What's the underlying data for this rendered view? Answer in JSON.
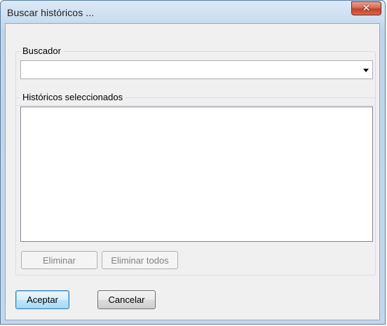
{
  "window": {
    "title": "Buscar históricos ..."
  },
  "titlebar": {
    "close_icon": "close-icon",
    "close_glyph": "✕"
  },
  "buscador": {
    "label": "Buscador",
    "value": ""
  },
  "historicos": {
    "label": "Históricos seleccionados",
    "items": []
  },
  "buttons": {
    "eliminar": "Eliminar",
    "eliminar_todos": "Eliminar todos",
    "aceptar": "Aceptar",
    "cancelar": "Cancelar"
  }
}
